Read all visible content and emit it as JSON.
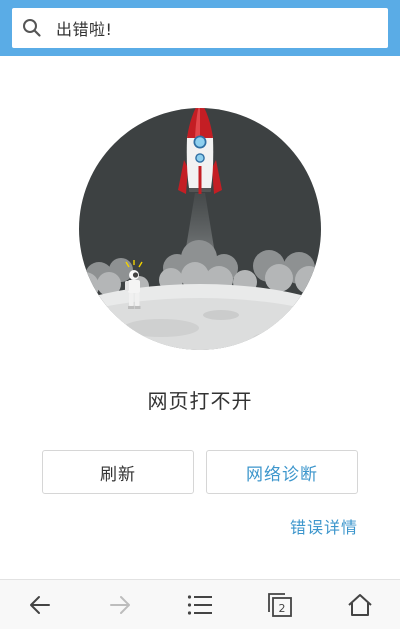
{
  "search_bar": {
    "text": "出错啦!",
    "icon": "search-icon"
  },
  "error": {
    "message": "网页打不开",
    "illustration": "rocket-astronaut-moon-illustration"
  },
  "actions": {
    "refresh_label": "刷新",
    "diagnose_label": "网络诊断",
    "details_label": "错误详情"
  },
  "bottom_nav": {
    "tab_count": "2",
    "items": [
      "back-arrow-icon",
      "forward-arrow-icon",
      "menu-icon",
      "tabs-icon",
      "home-icon"
    ]
  },
  "colors": {
    "top_bar": "#5aace6",
    "accent": "#3d96cc",
    "rocket_red": "#c41e24",
    "scene_dark": "#3d4142"
  }
}
